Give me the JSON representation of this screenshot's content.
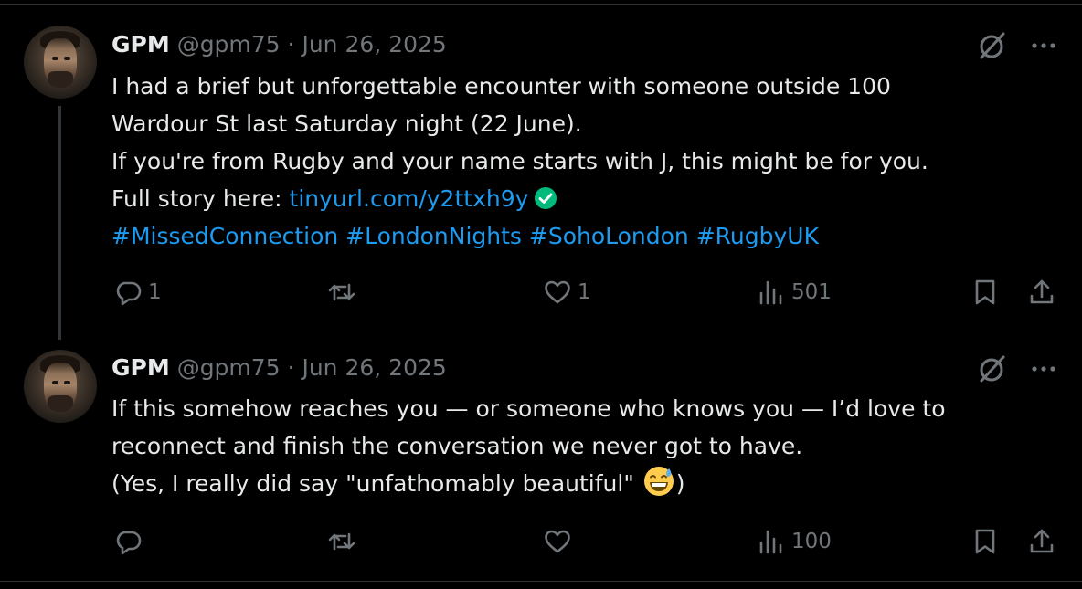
{
  "tweets": [
    {
      "author_name": "GPM",
      "handle": "@gpm75",
      "separator": "·",
      "date": "Jun 26, 2025",
      "lines": [
        "I had a brief but unforgettable encounter with someone outside 100",
        "Wardour St last Saturday night (22 June).",
        "If you're from Rugby and your name starts with J, this might be for you."
      ],
      "link_prefix": "Full story here: ",
      "link_text": "tinyurl.com/y2ttxh9y",
      "hashtags": "#MissedConnection #LondonNights #SohoLondon #RugbyUK",
      "replies": "1",
      "reposts": "",
      "likes": "1",
      "views": "501"
    },
    {
      "author_name": "GPM",
      "handle": "@gpm75",
      "separator": "·",
      "date": "Jun 26, 2025",
      "lines": [
        "If this somehow reaches you — or someone who knows you — I’d love to",
        "reconnect and finish the conversation we never got to have."
      ],
      "last_line_before_emoji": "(Yes, I really did say \"unfathomably beautiful\" ",
      "last_line_after_emoji": ")",
      "emoji": "grinning-face-with-sweat",
      "replies": "",
      "reposts": "",
      "likes": "",
      "views": "100"
    }
  ],
  "icons": {
    "grok": "grok-icon",
    "more": "more-icon",
    "verified": "verified-badge-icon",
    "reply": "reply-icon",
    "repost": "repost-icon",
    "like": "heart-icon",
    "views": "views-icon",
    "bookmark": "bookmark-icon",
    "share": "share-icon"
  },
  "colors": {
    "background": "#000000",
    "text": "#e7e9ea",
    "muted": "#71767b",
    "link": "#1d9bf0",
    "verified": "#00ba7c",
    "thread_line": "#333639"
  }
}
